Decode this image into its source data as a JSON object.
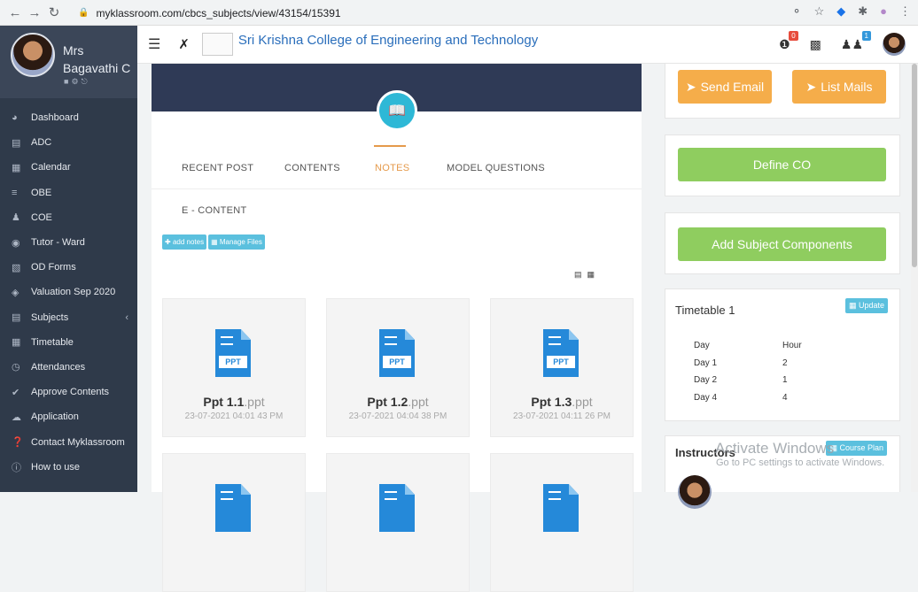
{
  "browser": {
    "url": "myklassroom.com/cbcs_subjects/view/43154/15391"
  },
  "profile": {
    "name": "Mrs Bagavathi C"
  },
  "sidebar": {
    "items": [
      {
        "label": "Dashboard",
        "icon": "dashboard-icon"
      },
      {
        "label": "ADC",
        "icon": "book-icon"
      },
      {
        "label": "Calendar",
        "icon": "calendar-icon"
      },
      {
        "label": "OBE",
        "icon": "list-icon"
      },
      {
        "label": "COE",
        "icon": "user-icon"
      },
      {
        "label": "Tutor - Ward",
        "icon": "eye-icon"
      },
      {
        "label": "OD Forms",
        "icon": "form-icon"
      },
      {
        "label": "Valuation Sep 2020",
        "icon": "check-icon"
      },
      {
        "label": "Subjects",
        "icon": "book-icon"
      },
      {
        "label": "Timetable",
        "icon": "table-icon"
      },
      {
        "label": "Attendances",
        "icon": "clock-icon"
      },
      {
        "label": "Approve Contents",
        "icon": "checkmark-icon"
      },
      {
        "label": "Application",
        "icon": "cloud-icon"
      },
      {
        "label": "Contact Myklassroom",
        "icon": "question-icon"
      },
      {
        "label": "How to use",
        "icon": "info-icon"
      }
    ]
  },
  "header": {
    "college_name": "Sri Krishna College of Engineering and Technology",
    "notif_badge": "0",
    "group_badge": "1",
    "badge_colors": {
      "notif": "#e74c3c",
      "group": "#3498db"
    }
  },
  "tabs": [
    {
      "label": "RECENT POST",
      "active": false
    },
    {
      "label": "CONTENTS",
      "active": false
    },
    {
      "label": "NOTES",
      "active": true
    },
    {
      "label": "MODEL QUESTIONS",
      "active": false
    }
  ],
  "section_title": "E - CONTENT",
  "actions": {
    "add_notes": "add notes",
    "manage_files": "Manage Files"
  },
  "files": [
    {
      "name": "Ppt 1.1",
      "ext": ".ppt",
      "date": "23-07-2021 04:01 43 PM",
      "icon_label": "PPT"
    },
    {
      "name": "Ppt 1.2",
      "ext": ".ppt",
      "date": "23-07-2021 04:04 38 PM",
      "icon_label": "PPT"
    },
    {
      "name": "Ppt 1.3",
      "ext": ".ppt",
      "date": "23-07-2021 04:11 26 PM",
      "icon_label": "PPT"
    }
  ],
  "right": {
    "send_email": "Send Email",
    "list_mails": "List Mails",
    "define_co": "Define CO",
    "add_components": "Add Subject Components",
    "timetable_title": "Timetable 1",
    "update": "Update",
    "timetable_headers": [
      "Day",
      "Hour"
    ],
    "timetable_rows": [
      [
        "Day 1",
        "2"
      ],
      [
        "Day 2",
        "1"
      ],
      [
        "Day 4",
        "4"
      ]
    ],
    "instructors_title": "Instructors",
    "course_plan": "Course Plan"
  },
  "watermark": {
    "line1": "Activate Windows",
    "line2": "Go to PC settings to activate Windows."
  },
  "colors": {
    "sidebar_bg": "#2f3a4a",
    "accent_orange": "#e59a4b",
    "btn_orange": "#f5ad4a",
    "btn_green": "#8fcd5f",
    "info_blue": "#5bc0de",
    "banner": "#2f3a56"
  }
}
